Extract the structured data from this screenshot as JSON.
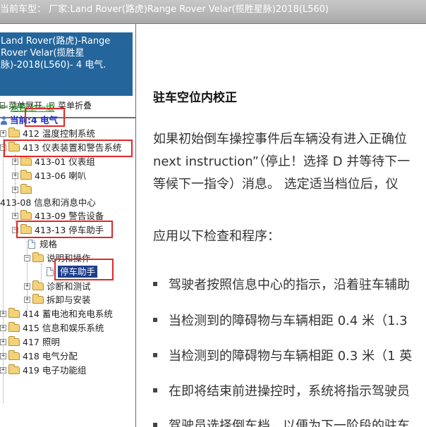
{
  "window": {
    "title": "当前车型：  厂家:Land Rover(路虎)Range Rover Velar(揽胜星脉)2018(L560)"
  },
  "sidebar": {
    "vehicle_lines": [
      "Land Rover(路虎)-Range",
      "Rover Velar(揽胜星",
      "脉)-2018(L560)- 4 电气."
    ],
    "expand_all": "菜单展开",
    "collapse_all": "菜单折叠",
    "back_link": "返回上一级",
    "current": "当前:4 电气",
    "tree": {
      "n412": "412 温度控制系统",
      "n413": "413 仪表装置和警告系统",
      "n41301": "413-01 仪表组",
      "n41306": "413-06 喇叭",
      "n41308": "413-08 信息和消息中心",
      "n41309": "413-09 警告设备",
      "n41313": "413-13 停车助手",
      "spec": "规格",
      "desc_op": "说明和操作",
      "parking_aid": "停车助手",
      "diag": "诊断和测试",
      "removal": "拆卸与安装",
      "n414": "414 蓄电池和充电系统",
      "n415": "415 信息和娱乐系统",
      "n417": "417 照明",
      "n418": "418 电气分配",
      "n419": "419 电子功能组"
    }
  },
  "content": {
    "heading": "驻车空位内校正",
    "para_lines": [
      "如果初始倒车操控事件后车辆没有进入正确位",
      "next instruction”（停止！选择 D 并等待下一",
      "等候下一指令）消息。 选定适当档位后，仪"
    ],
    "checks_intro": "应用以下检查和程序：",
    "bullets": [
      "驾驶者按照信息中心的指示，沿着驻车辅助",
      "当检测到的障碍物与车辆相距 0.4 米（1.3",
      "当检测到的障碍物与车辆相距 0.3 米（1 英",
      "在即将结束前进操控时，系统将指示驾驶员",
      "驾驶员选择倒车档，以便为下一阶段的驻车"
    ]
  },
  "colors": {
    "vehicle_header_bg": "#24669c",
    "highlight_box": "#e02828",
    "selected_bg": "#1f3f8a"
  }
}
